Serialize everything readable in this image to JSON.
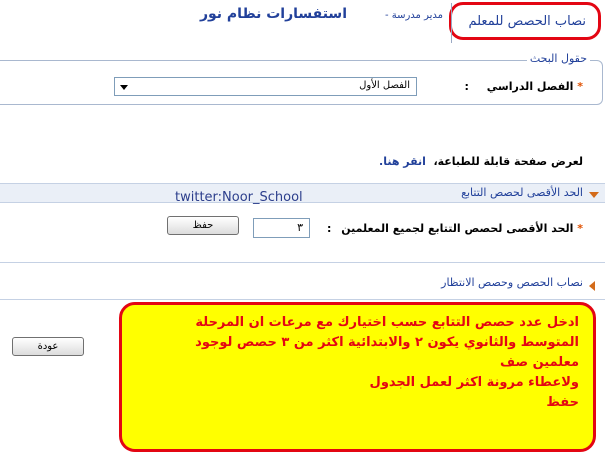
{
  "header": {
    "tab_label": "نصاب الحصص للمعلم",
    "app_title": "استفسارات نظام نور",
    "role_text": "مدير مدرسة -"
  },
  "search": {
    "legend": "حقول البحث",
    "required_mark": "*",
    "semester_label": "الفصل الدراسي",
    "colon": ":",
    "semester_value": "الفصل الأول"
  },
  "print": {
    "text": "لعرض صفحة قابلة للطباعة،",
    "link": "انقر هنا."
  },
  "section_continuous": {
    "title": "الحد الأقصى لحصص التتابع",
    "watermark": "twitter:Noor_School",
    "required_mark": "*",
    "field_label": "الحد الأقصى لحصص التتابع لجميع المعلمين",
    "colon": ":",
    "value": "٣",
    "save_label": "حفظ"
  },
  "section_waiting": {
    "title": "نصاب الحصص وحصص الانتظار"
  },
  "footer": {
    "back_label": "عودة"
  },
  "annotation": {
    "line1": "ادخل عدد حصص التتابع  حسب اختيارك مع مرعات ان المرحلة",
    "line2": "المتوسط والثانوي يكون ٢ والابتدائية اكثر من ٣ حصص لوجود",
    "line3": "معلمين صف",
    "line4": "ولاعطاء مرونة اكثر لعمل الجدول",
    "line5": "حفظ"
  },
  "colors": {
    "accent_blue": "#21409a",
    "highlight_red": "#e30613",
    "note_yellow": "#ffff00",
    "arrow_orange": "#d36b1a"
  }
}
